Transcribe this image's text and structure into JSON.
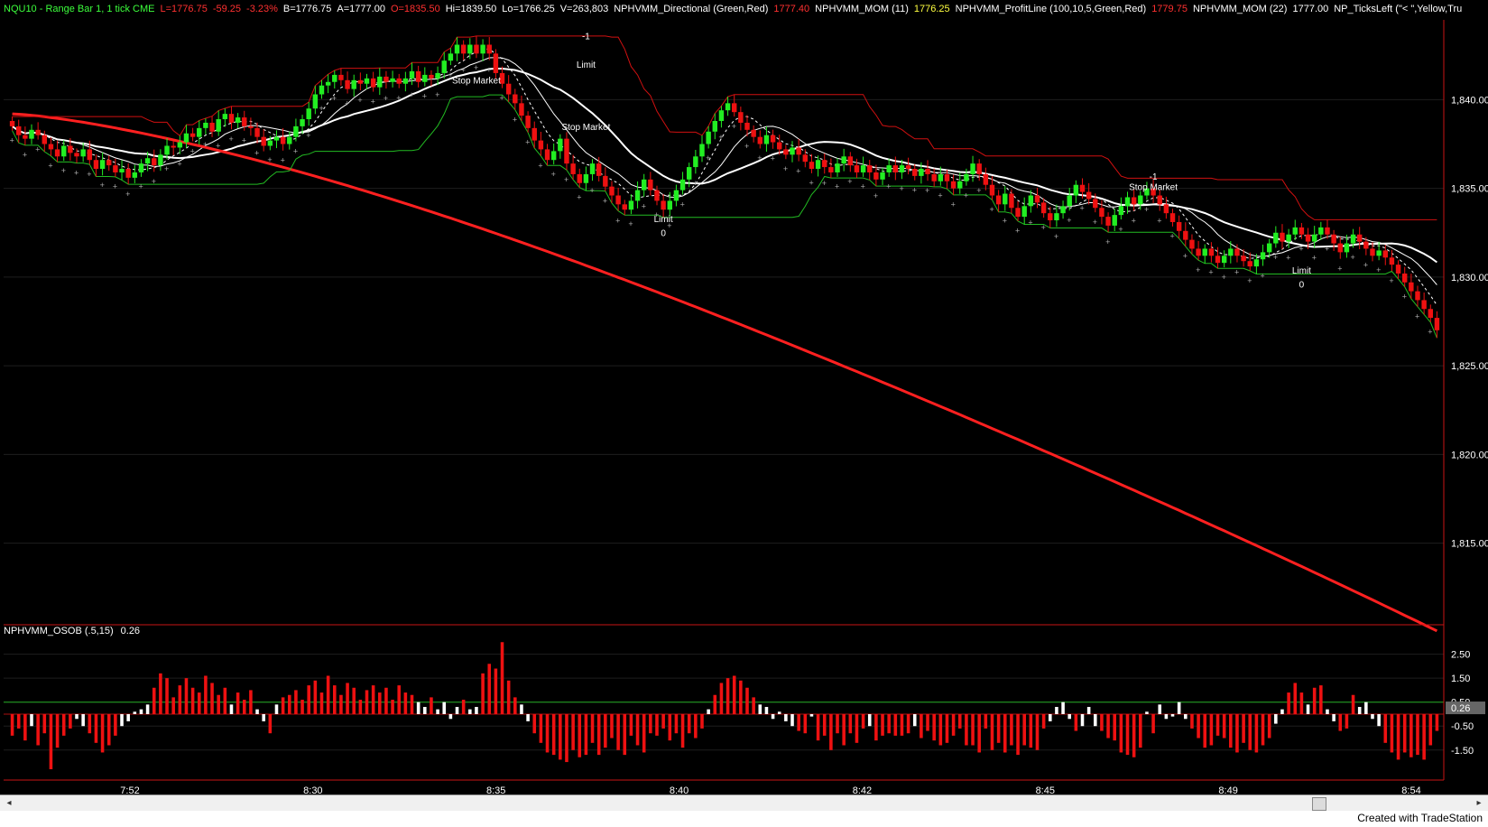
{
  "header": {
    "items": [
      {
        "text": "NQU10 - Range Bar 1, 1 tick  CME",
        "color": "#3cff3c"
      },
      {
        "text": "L=1776.75",
        "color": "#ff3030"
      },
      {
        "text": "-59.25",
        "color": "#ff3030"
      },
      {
        "text": "-3.23%",
        "color": "#ff3030"
      },
      {
        "text": "B=1776.75",
        "color": "#ffffff"
      },
      {
        "text": "A=1777.00",
        "color": "#ffffff"
      },
      {
        "text": "O=1835.50",
        "color": "#ff3030"
      },
      {
        "text": "Hi=1839.50",
        "color": "#ffffff"
      },
      {
        "text": "Lo=1766.25",
        "color": "#ffffff"
      },
      {
        "text": "V=263,803",
        "color": "#ffffff"
      },
      {
        "text": "NPHVMM_Directional (Green,Red)",
        "color": "#ffffff"
      },
      {
        "text": "1777.40",
        "color": "#ff3030"
      },
      {
        "text": "NPHVMM_MOM (11)",
        "color": "#ffffff"
      },
      {
        "text": "1776.25",
        "color": "#ffff40"
      },
      {
        "text": "NPHVMM_ProfitLine (100,10,5,Green,Red)",
        "color": "#ffffff"
      },
      {
        "text": "1779.75",
        "color": "#ff3030"
      },
      {
        "text": "NPHVMM_MOM (22)",
        "color": "#ffffff"
      },
      {
        "text": "1777.00",
        "color": "#ffffff"
      },
      {
        "text": "NP_TicksLeft (\"< \",Yellow,Tru",
        "color": "#ffffff"
      }
    ]
  },
  "sub_header": {
    "name": "NPHVMM_OSOB (.5,15)",
    "value": "0.26"
  },
  "price_axis": {
    "ticks": [
      "1,840.00",
      "1,835.00",
      "1,830.00",
      "1,825.00",
      "1,820.00",
      "1,815.00"
    ]
  },
  "osc_axis": {
    "ticks": [
      "2.50",
      "1.50",
      "0.50",
      "-0.50",
      "-1.50"
    ],
    "current": "0.26"
  },
  "time_axis": {
    "ticks": [
      "7:52",
      "8:30",
      "8:35",
      "8:40",
      "8:42",
      "8:45",
      "8:49",
      "8:54"
    ]
  },
  "annotations": [
    {
      "text": "Stop Market"
    },
    {
      "text": "-1"
    },
    {
      "text": "Limit"
    },
    {
      "text": "Stop Market"
    },
    {
      "text": "Limit"
    },
    {
      "text": "0"
    },
    {
      "text": "-1"
    },
    {
      "text": "Stop Market"
    },
    {
      "text": "Limit"
    },
    {
      "text": "0"
    }
  ],
  "footer": {
    "text": "Created with TradeStation"
  },
  "colors": {
    "up": "#22ee22",
    "down": "#ee1111",
    "ma": "#ff2020",
    "osc": "#ee1111",
    "grid": "#1e1e1e",
    "axis_border": "#c81414"
  },
  "chart_data": [
    {
      "type": "candlestick",
      "title": "NQU10 - Range Bar 1, 1 tick",
      "ylim": [
        1810.5,
        1844.5
      ],
      "close": [
        1838.5,
        1838,
        1837.8,
        1838.3,
        1838,
        1837.5,
        1837.2,
        1836.8,
        1837.4,
        1837,
        1836.8,
        1837.2,
        1836.6,
        1836.1,
        1836.6,
        1836.3,
        1835.9,
        1836.1,
        1835.6,
        1835.9,
        1836.4,
        1836.7,
        1836.3,
        1836.9,
        1837.4,
        1837.3,
        1837.6,
        1838.1,
        1837.9,
        1838.4,
        1838.7,
        1838.2,
        1838.9,
        1839.2,
        1838.7,
        1839,
        1838.5,
        1838.4,
        1837.9,
        1837.4,
        1837.7,
        1837.9,
        1837.5,
        1837.9,
        1838.5,
        1838.9,
        1839.5,
        1840.3,
        1840.8,
        1841,
        1841.4,
        1841.1,
        1840.6,
        1841.1,
        1840.9,
        1841.2,
        1840.7,
        1841.3,
        1841,
        1841.2,
        1840.9,
        1841.2,
        1841.6,
        1841,
        1841.4,
        1841.2,
        1841.5,
        1842.2,
        1842.6,
        1843.1,
        1842.6,
        1843.1,
        1842.6,
        1843.1,
        1842.6,
        1841.5,
        1840.9,
        1840.3,
        1839.8,
        1839.1,
        1838.4,
        1837.7,
        1837.2,
        1836.6,
        1837.1,
        1837.8,
        1836.4,
        1835.8,
        1835.3,
        1835.8,
        1836.4,
        1835.7,
        1835.1,
        1834.6,
        1834.1,
        1833.8,
        1834.3,
        1834.9,
        1835.5,
        1834.9,
        1834.3,
        1833.8,
        1834.3,
        1834.9,
        1835.5,
        1836.2,
        1836.8,
        1837.5,
        1838.2,
        1838.8,
        1839.4,
        1839.8,
        1839.3,
        1838.7,
        1838.3,
        1837.9,
        1837.5,
        1838,
        1837.6,
        1837.2,
        1836.9,
        1837.3,
        1836.9,
        1836.5,
        1836.1,
        1836.6,
        1836.2,
        1835.9,
        1836.4,
        1836.8,
        1836.3,
        1835.9,
        1836.3,
        1835.9,
        1835.5,
        1835.9,
        1836.3,
        1835.9,
        1836.3,
        1836.1,
        1835.7,
        1836.1,
        1835.8,
        1835.4,
        1835.8,
        1835.4,
        1835,
        1835.4,
        1835.8,
        1836.4,
        1835.8,
        1835.2,
        1834.6,
        1834.1,
        1834.7,
        1833.9,
        1833.4,
        1834,
        1834.6,
        1834.2,
        1833.6,
        1833.2,
        1833.6,
        1834,
        1834.6,
        1835.2,
        1834.8,
        1834.4,
        1833.9,
        1833.4,
        1832.9,
        1833.5,
        1834,
        1834.5,
        1834.1,
        1834.6,
        1835,
        1834.6,
        1834.1,
        1833.6,
        1833.1,
        1832.6,
        1832.1,
        1831.6,
        1831.2,
        1831.6,
        1831.2,
        1830.8,
        1831.2,
        1831.6,
        1831.2,
        1830.9,
        1830.6,
        1831,
        1831.4,
        1831.9,
        1832.5,
        1832,
        1832.4,
        1832.8,
        1832.4,
        1832,
        1832.4,
        1832.8,
        1832.4,
        1831.9,
        1831.4,
        1831.9,
        1832.4,
        1832,
        1831.6,
        1831.2,
        1831.5,
        1831.1,
        1830.7,
        1830.2,
        1829.7,
        1829.2,
        1828.7,
        1828.2,
        1827.7,
        1827
      ]
    },
    {
      "type": "bar",
      "title": "NPHVMM_OSOB (.5,15)",
      "ylim": [
        -2.6,
        3.2
      ],
      "values": [
        -0.9,
        -0.6,
        -1.1,
        -0.5,
        -1.3,
        -0.8,
        -2.3,
        -1.4,
        -0.9,
        -0.6,
        -0.2,
        -0.5,
        -0.8,
        -1.2,
        -1.6,
        -1.3,
        -0.9,
        -0.5,
        -0.3,
        0.1,
        0.2,
        0.4,
        1.1,
        1.7,
        1.5,
        0.7,
        1.2,
        1.5,
        1.1,
        0.9,
        1.6,
        1.3,
        0.8,
        1.1,
        0.4,
        0.9,
        0.6,
        1.0,
        0.2,
        -0.3,
        -0.8,
        0.4,
        0.7,
        0.8,
        1.0,
        0.6,
        1.2,
        1.4,
        0.9,
        1.6,
        1.2,
        0.8,
        1.3,
        1.1,
        0.6,
        1.0,
        1.2,
        0.9,
        1.1,
        0.6,
        1.2,
        0.9,
        0.8,
        0.5,
        0.3,
        0.7,
        0.2,
        0.5,
        -0.2,
        0.3,
        0.6,
        0.2,
        0.3,
        1.7,
        2.1,
        1.9,
        3.0,
        1.4,
        0.7,
        0.4,
        -0.3,
        -0.8,
        -1.2,
        -1.6,
        -1.7,
        -1.9,
        -2.0,
        -1.5,
        -1.8,
        -1.7,
        -1.2,
        -1.7,
        -1.4,
        -1.0,
        -1.5,
        -1.7,
        -0.9,
        -1.3,
        -1.6,
        -0.8,
        -0.9,
        -0.6,
        -1.1,
        -0.8,
        -1.4,
        -0.8,
        -1.0,
        -0.6,
        0.2,
        0.8,
        1.3,
        1.5,
        1.6,
        1.4,
        1.1,
        0.7,
        0.4,
        0.3,
        -0.2,
        0.1,
        -0.3,
        -0.5,
        -0.7,
        -0.8,
        -0.1,
        -1.1,
        -0.9,
        -1.5,
        -0.8,
        -1.3,
        -0.8,
        -1.2,
        -0.6,
        -0.5,
        -1.1,
        -0.9,
        -0.8,
        -0.9,
        -0.9,
        -0.8,
        -0.5,
        -1.0,
        -0.7,
        -1.1,
        -1.3,
        -1.2,
        -0.9,
        -0.6,
        -1.3,
        -1.3,
        -1.6,
        -0.6,
        -1.5,
        -1.2,
        -1.6,
        -1.3,
        -1.7,
        -1.3,
        -1.4,
        -1.5,
        -0.6,
        -0.3,
        0.3,
        0.5,
        -0.2,
        -0.7,
        -0.5,
        0.3,
        -0.5,
        -0.7,
        -1.0,
        -1.1,
        -1.6,
        -1.7,
        -1.8,
        -1.4,
        0.1,
        -0.8,
        0.4,
        -0.2,
        -0.1,
        0.5,
        -0.2,
        -0.6,
        -1.0,
        -1.4,
        -1.3,
        -0.9,
        -1.0,
        -1.4,
        -1.6,
        -1.2,
        -1.5,
        -1.6,
        -1.3,
        -1.0,
        -0.4,
        0.2,
        0.9,
        1.3,
        0.9,
        0.4,
        1.1,
        1.2,
        0.2,
        -0.3,
        -0.7,
        -0.6,
        0.8,
        0.3,
        0.5,
        -0.2,
        -0.5,
        -1.2,
        -1.6,
        -1.9,
        -1.6,
        -1.8,
        -1.7,
        -1.9,
        -1.3,
        -0.7
      ]
    }
  ]
}
